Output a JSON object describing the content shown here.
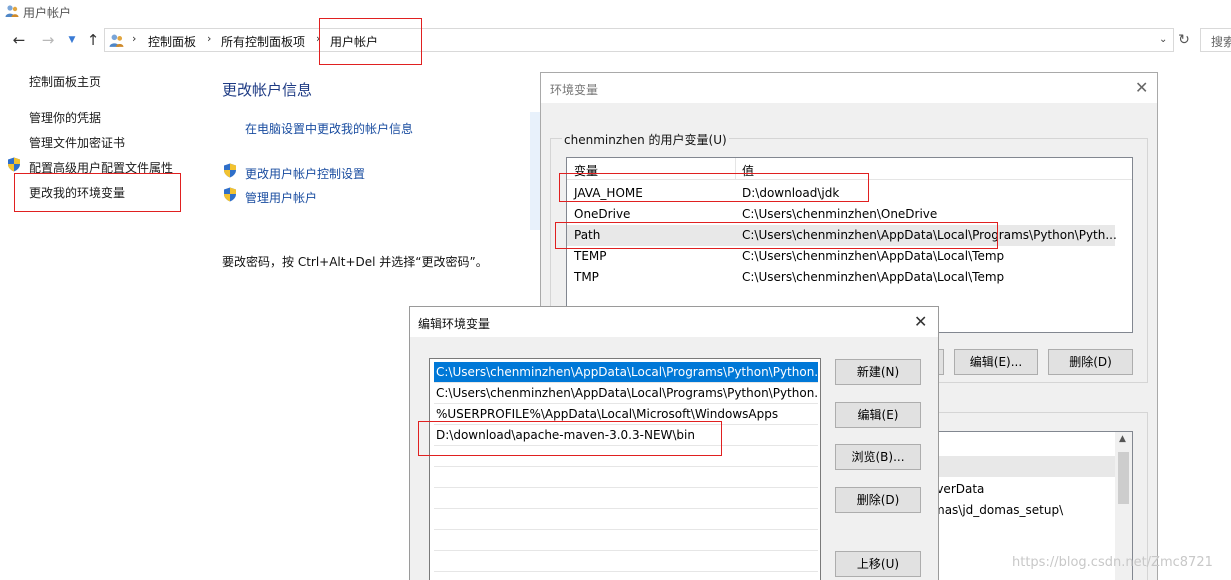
{
  "window": {
    "title": "用户帐户",
    "icon": "users-icon"
  },
  "navbar": {
    "breadcrumbs": [
      "控制面板",
      "所有控制面板项",
      "用户帐户"
    ],
    "search_label": "搜索"
  },
  "leftnav": {
    "home": "控制面板主页",
    "items": [
      "管理你的凭据",
      "管理文件加密证书",
      "配置高级用户配置文件属性",
      "更改我的环境变量"
    ]
  },
  "main": {
    "title": "更改帐户信息",
    "link_pc_settings": "在电脑设置中更改我的帐户信息",
    "link_uac": "更改用户帐户控制设置",
    "link_manage": "管理用户帐户",
    "password_hint": "要改密码，按 Ctrl+Alt+Del 并选择“更改密码”。"
  },
  "env_dialog": {
    "title": "环境变量",
    "user_group_label": "chenminzhen 的用户变量(U)",
    "columns": [
      "变量",
      "值"
    ],
    "user_vars": [
      {
        "name": "JAVA_HOME",
        "value": "D:\\download\\jdk"
      },
      {
        "name": "OneDrive",
        "value": "C:\\Users\\chenminzhen\\OneDrive"
      },
      {
        "name": "Path",
        "value": "C:\\Users\\chenminzhen\\AppData\\Local\\Programs\\Python\\Pyth..."
      },
      {
        "name": "TEMP",
        "value": "C:\\Users\\chenminzhen\\AppData\\Local\\Temp"
      },
      {
        "name": "TMP",
        "value": "C:\\Users\\chenminzhen\\AppData\\Local\\Temp"
      }
    ],
    "selected_user_var": "Path",
    "edit_button": "编辑(E)...",
    "delete_button": "删除(D)",
    "system_partial": [
      "iverData",
      "mas\\jd_domas_setup\\"
    ]
  },
  "edit_dialog": {
    "title": "编辑环境变量",
    "entries": [
      "C:\\Users\\chenminzhen\\AppData\\Local\\Programs\\Python\\Python...",
      "C:\\Users\\chenminzhen\\AppData\\Local\\Programs\\Python\\Python...",
      "%USERPROFILE%\\AppData\\Local\\Microsoft\\WindowsApps",
      "D:\\download\\apache-maven-3.0.3-NEW\\bin"
    ],
    "selected_index": 0,
    "buttons": {
      "new": "新建(N)",
      "edit": "编辑(E)",
      "browse": "浏览(B)...",
      "delete": "删除(D)",
      "move_up": "上移(U)"
    }
  },
  "watermark": "https://blog.csdn.net/Zmc8721",
  "colors": {
    "link": "#1a4da0",
    "title": "#1e3b84",
    "highlight_box": "#e02020",
    "selection": "#0078d7"
  }
}
